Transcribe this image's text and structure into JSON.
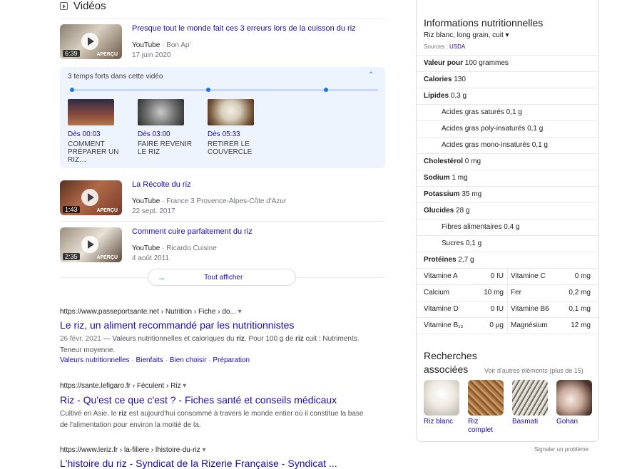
{
  "videos_section": {
    "title": "Vidéos",
    "items": [
      {
        "title": "Presque tout le monde fait ces 3 erreurs lors de la cuisson du riz",
        "source": "YouTube",
        "channel": "Bon Ap'",
        "date": "17 juin 2020",
        "duration": "6:39",
        "preview": "APERÇU"
      },
      {
        "title": "La Récolte du riz",
        "source": "YouTube",
        "channel": "France 3 Provence-Alpes-Côte d'Azur",
        "date": "22 sept. 2017",
        "duration": "1:43",
        "preview": "APERÇU"
      },
      {
        "title": "Comment cuire parfaitement du riz",
        "source": "YouTube",
        "channel": "Ricardo Cuisine",
        "date": "4 août 2011",
        "duration": "2:35",
        "preview": "APERÇU"
      }
    ],
    "highlights": {
      "header": "3 temps forts dans cette vidéo",
      "moments": [
        {
          "time": "Dès 00:03",
          "label": "COMMENT PRÉPARER UN RIZ…"
        },
        {
          "time": "Dès 03:00",
          "label": "FAIRE REVENIR LE RIZ"
        },
        {
          "time": "Dès 05:33",
          "label": "RETIRER LE COUVERCLE"
        }
      ]
    },
    "show_all": "Tout afficher"
  },
  "results": [
    {
      "url": "https://www.passeportsante.net › Nutrition › Fiche › do...",
      "title": "Le riz, un aliment recommandé par les nutritionnistes",
      "snippet_date": "26 févr. 2021",
      "snippet": "Valeurs nutritionnelles et caloriques du riz. Pour 100 g de riz cuit : Nutriments. Teneur moyenne.",
      "links": [
        "Valeurs nutritionnelles",
        "Bienfaits",
        "Bien choisir",
        "Préparation"
      ]
    },
    {
      "url": "https://sante.lefigaro.fr › Féculent › Riz",
      "title": "Riz - Qu'est ce que c'est ? - Fiches santé et conseils médicaux",
      "snippet_line1": "Cultivé en Asie, le riz est aujourd'hui consommé à travers le monde entier où il constitue la base",
      "snippet_line2": "de l'alimentation pour environ la moitié de la."
    },
    {
      "url": "https://www.leriz.fr › la-filiere › lhistoire-du-riz",
      "title": "L'histoire du riz - Syndicat de la Rizerie Française - Syndicat ..."
    }
  ],
  "nutrition": {
    "title": "Informations nutritionnelles",
    "food": "Riz blanc, long grain, cuit",
    "sources_label": "Sources :",
    "source": "USDA",
    "rows": [
      {
        "bold": "Valeur pour",
        "value": "100 grammes"
      },
      {
        "bold": "Calories",
        "value": "130"
      },
      {
        "bold": "Lipides",
        "value": "0,3 g"
      },
      {
        "sub": "Acides gras saturés",
        "value": "0,1 g"
      },
      {
        "sub": "Acides gras poly-insaturés",
        "value": "0,1 g"
      },
      {
        "sub": "Acides gras mono-insaturés",
        "value": "0,1 g"
      },
      {
        "bold": "Cholestérol",
        "value": "0 mg"
      },
      {
        "bold": "Sodium",
        "value": "1 mg"
      },
      {
        "bold": "Potassium",
        "value": "35 mg"
      },
      {
        "bold": "Glucides",
        "value": "28 g"
      },
      {
        "sub": "Fibres alimentaires",
        "value": "0,4 g"
      },
      {
        "sub": "Sucres",
        "value": "0,1 g"
      },
      {
        "bold": "Protéines",
        "value": "2,7 g"
      }
    ],
    "vitamins": [
      {
        "l_name": "Vitamine A",
        "l_val": "0 IU",
        "r_name": "Vitamine C",
        "r_val": "0 mg"
      },
      {
        "l_name": "Calcium",
        "l_val": "10 mg",
        "r_name": "Fer",
        "r_val": "0,2 mg"
      },
      {
        "l_name": "Vitamine D",
        "l_val": "0 IU",
        "r_name": "Vitamine B6",
        "r_val": "0,1 mg"
      },
      {
        "l_name": "Vitamine B₁₂",
        "l_val": "0 µg",
        "r_name": "Magnésium",
        "r_val": "12 mg"
      }
    ]
  },
  "related": {
    "title_line1": "Recherches",
    "title_line2": "associées",
    "more": "Voir d'autres éléments (plus de 15)",
    "items": [
      {
        "label": "Riz blanc"
      },
      {
        "label": "Riz complet"
      },
      {
        "label": "Basmati"
      },
      {
        "label": "Gohan"
      }
    ]
  },
  "report": "Signaler un problème"
}
